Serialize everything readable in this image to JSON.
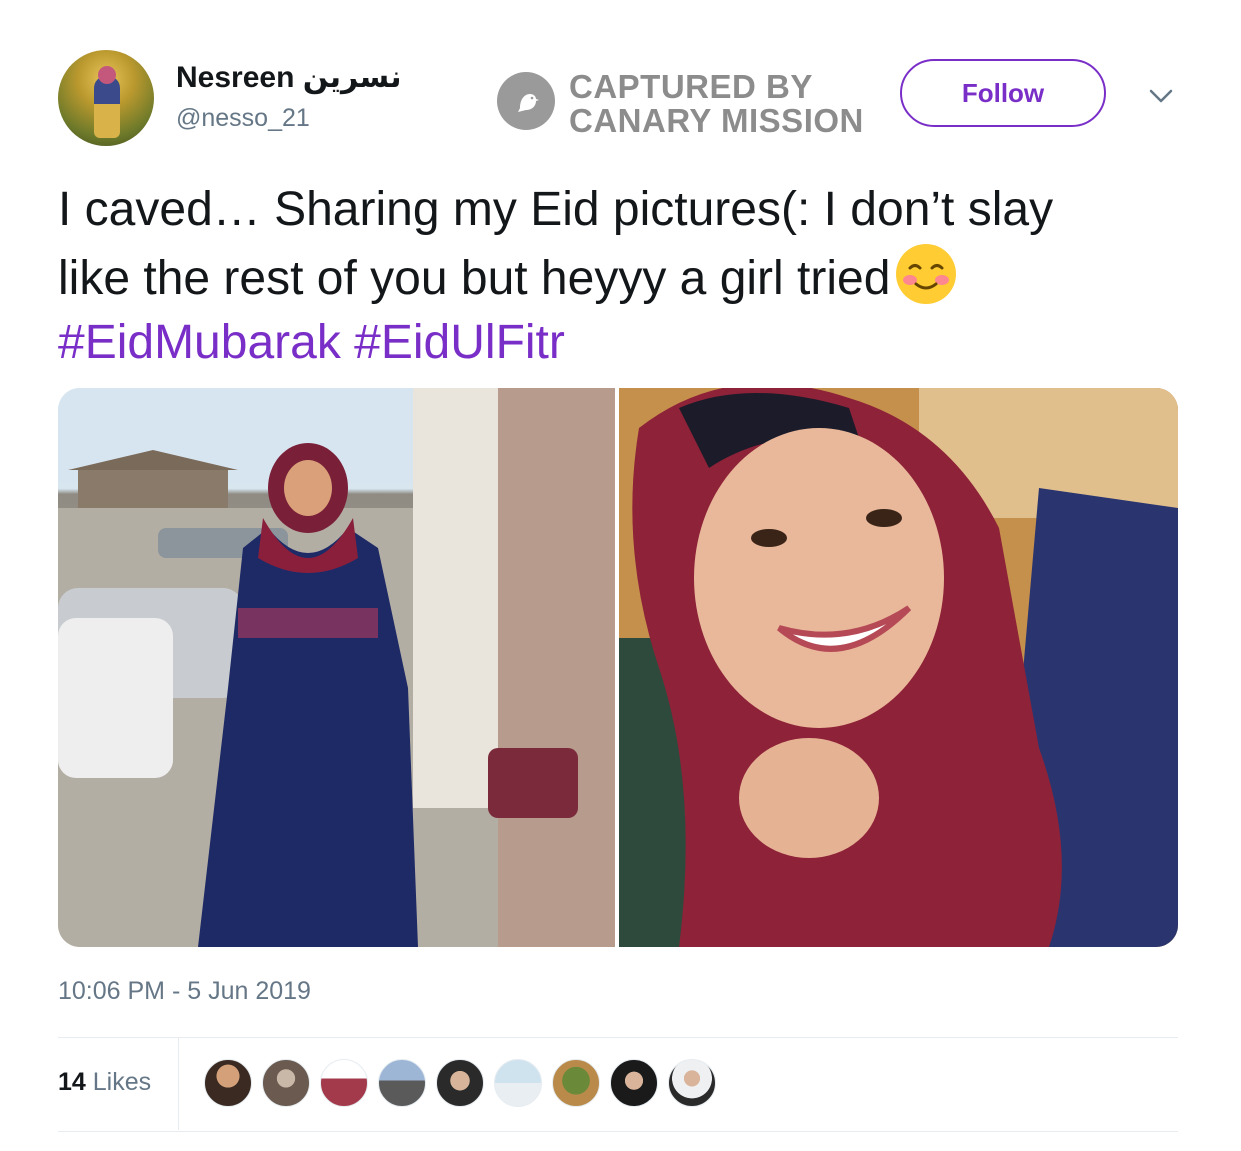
{
  "author": {
    "display_name": "Nesreen نسرين",
    "handle": "@nesso_21",
    "avatar_icon": "profile-photo"
  },
  "watermark": {
    "line1": "CAPTURED BY",
    "line2": "CANARY MISSION",
    "icon": "canary-bird-icon"
  },
  "follow_button": {
    "label": "Follow"
  },
  "menu": {
    "icon": "chevron-down-icon"
  },
  "tweet": {
    "line1": "I caved… Sharing my Eid pictures(: I don’t slay",
    "line2": "like the rest of you but heyyy a girl tried",
    "emoji": "smiling-face-with-blush-icon",
    "hashtags": [
      "#EidMubarak",
      "#EidUlFitr"
    ]
  },
  "media": {
    "photos": [
      "photo-outdoor-full-length",
      "photo-selfie-closeup"
    ]
  },
  "timestamp": "10:06 PM - 5 Jun 2019",
  "likes": {
    "count": "14",
    "label": "Likes",
    "avatars": [
      "liker-1",
      "liker-2",
      "liker-3",
      "liker-4",
      "liker-5",
      "liker-6",
      "liker-7",
      "liker-8",
      "liker-9"
    ]
  },
  "colors": {
    "accent": "#7a2ec8",
    "secondary_text": "#657786",
    "primary_text": "#14171a",
    "watermark_gray": "#8c8c8c"
  }
}
